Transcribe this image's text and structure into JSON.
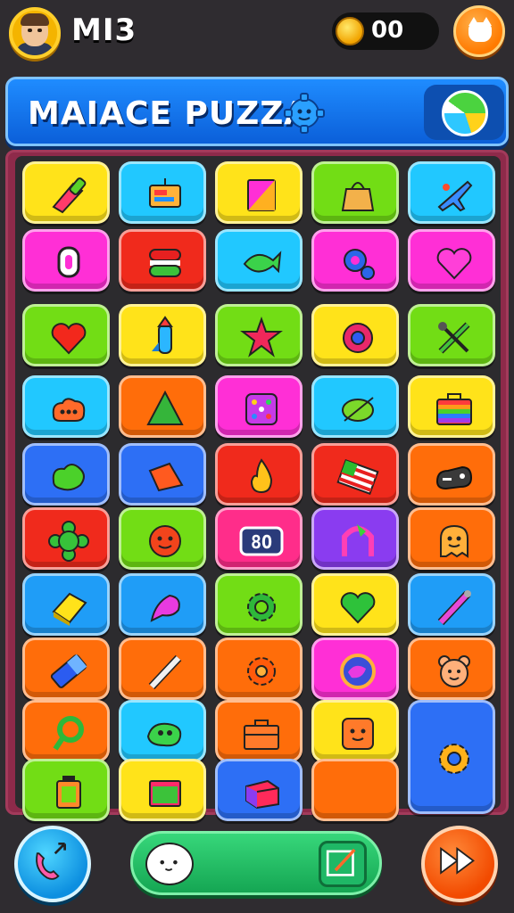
{
  "player": {
    "name": "MI3"
  },
  "currency": {
    "value": "00"
  },
  "banner": {
    "title": "MAIACE PUZZA"
  },
  "colors": {
    "background": "#2f2c30",
    "banner": "#1f8cff",
    "board_frame": "#8e2a4a"
  },
  "board": {
    "rows": 10,
    "cols": 5,
    "tiles": [
      {
        "color": "yellow",
        "icon": "lipstick-icon"
      },
      {
        "color": "cyan",
        "icon": "sign-icon"
      },
      {
        "color": "yellow",
        "icon": "notebook-icon"
      },
      {
        "color": "green",
        "icon": "bag-icon"
      },
      {
        "color": "cyan",
        "icon": "plane-icon"
      },
      {
        "color": "magenta",
        "icon": "zero-icon"
      },
      {
        "color": "red",
        "icon": "macaron-icon"
      },
      {
        "color": "cyan",
        "icon": "fish-icon"
      },
      {
        "color": "magenta",
        "icon": "gear-icon"
      },
      {
        "color": "magenta",
        "icon": "heart-icon"
      },
      {
        "color": "green",
        "icon": "heart-icon"
      },
      {
        "color": "yellow",
        "icon": "rocket-icon"
      },
      {
        "color": "green",
        "icon": "star-icon"
      },
      {
        "color": "yellow",
        "icon": "donut-icon"
      },
      {
        "color": "green",
        "icon": "tools-icon"
      },
      {
        "color": "cyan",
        "icon": "cloud-icon"
      },
      {
        "color": "orange",
        "icon": "triangle-icon"
      },
      {
        "color": "magenta",
        "icon": "dice-icon"
      },
      {
        "color": "cyan",
        "icon": "leaf-icon"
      },
      {
        "color": "yellow",
        "icon": "rainbow-case-icon"
      },
      {
        "color": "blue",
        "icon": "blob-icon"
      },
      {
        "color": "blue",
        "icon": "wedge-icon"
      },
      {
        "color": "red",
        "icon": "flame-icon"
      },
      {
        "color": "red",
        "icon": "flag-icon"
      },
      {
        "color": "orange",
        "icon": "gamepad-icon"
      },
      {
        "color": "red",
        "icon": "flower-icon"
      },
      {
        "color": "green",
        "icon": "smiley-blob-icon"
      },
      {
        "color": "pink",
        "icon": "counter-icon"
      },
      {
        "color": "purple",
        "icon": "arch-icon"
      },
      {
        "color": "orange",
        "icon": "ghost-icon"
      },
      {
        "color": "lblue",
        "icon": "block-icon"
      },
      {
        "color": "lblue",
        "icon": "shell-icon"
      },
      {
        "color": "green",
        "icon": "cog-icon"
      },
      {
        "color": "yellow",
        "icon": "heart-icon"
      },
      {
        "color": "lblue",
        "icon": "wand-icon"
      },
      {
        "color": "orange",
        "icon": "eraser-icon"
      },
      {
        "color": "orange",
        "icon": "pen-icon"
      },
      {
        "color": "orange",
        "icon": "gear-icon"
      },
      {
        "color": "magenta",
        "icon": "clock-icon"
      },
      {
        "color": "orange",
        "icon": "bear-icon"
      },
      {
        "color": "orange",
        "icon": "ring-icon"
      },
      {
        "color": "cyan",
        "icon": "creature-icon"
      },
      {
        "color": "orange",
        "icon": "toolbox-icon"
      },
      {
        "color": "yellow",
        "icon": "face-box-icon"
      },
      {
        "color": "blue",
        "icon": "sun-icon"
      },
      {
        "color": "green",
        "icon": "jar-icon"
      },
      {
        "color": "yellow",
        "icon": "screen-icon"
      },
      {
        "color": "blue",
        "icon": "cube-icon"
      },
      {
        "color": "orange",
        "icon": "none"
      }
    ],
    "counter_text": "8O"
  }
}
